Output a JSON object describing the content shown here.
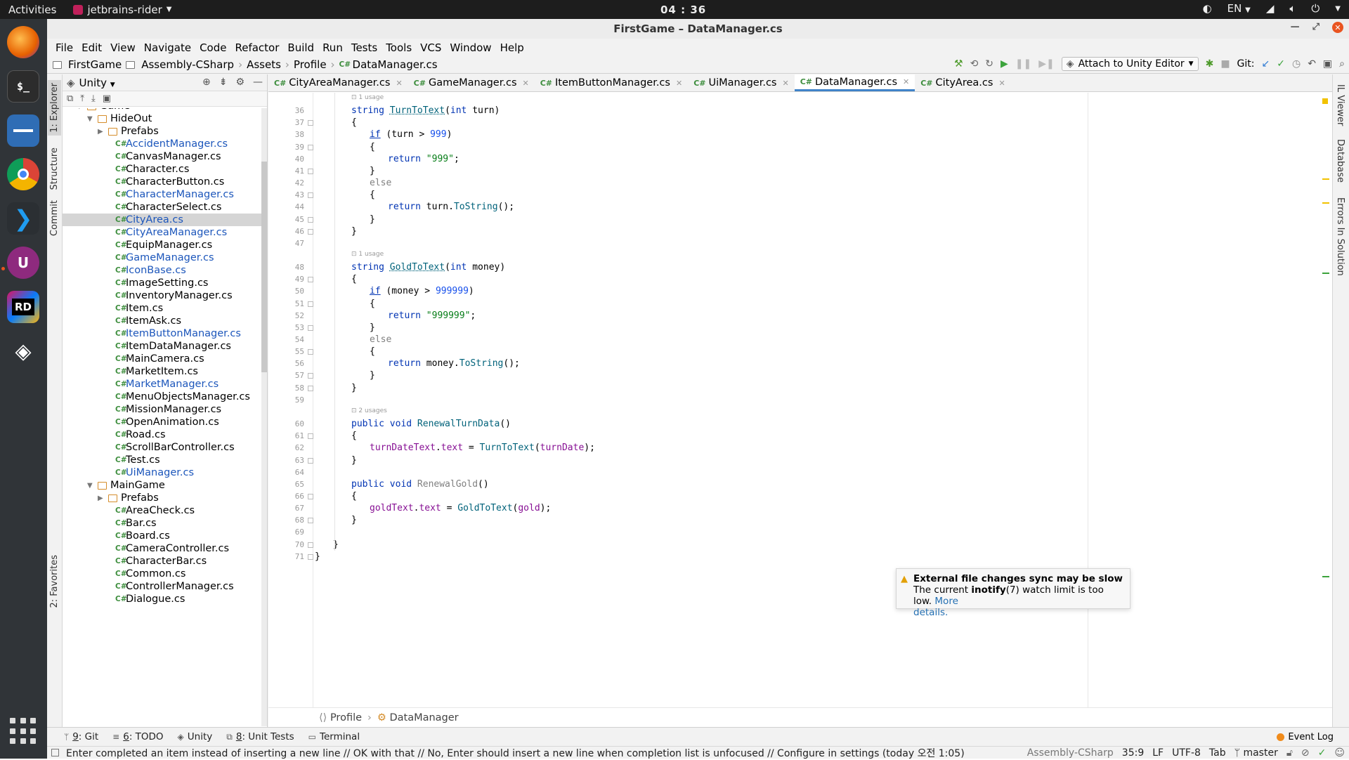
{
  "topbar": {
    "activities": "Activities",
    "app": "jetbrains-rider",
    "clock": "04 : 36",
    "lang": "EN"
  },
  "window": {
    "title": "FirstGame – DataManager.cs"
  },
  "menu": [
    "File",
    "Edit",
    "View",
    "Navigate",
    "Code",
    "Refactor",
    "Build",
    "Run",
    "Tests",
    "Tools",
    "VCS",
    "Window",
    "Help"
  ],
  "nav": {
    "crumbs": [
      "FirstGame",
      "Assembly-CSharp",
      "Assets",
      "Profile",
      "DataManager.cs"
    ],
    "attach": "Attach to Unity Editor",
    "git": "Git:"
  },
  "explorer": {
    "title": "Unity"
  },
  "tree": [
    {
      "label": "Game",
      "type": "folder",
      "depth": 0,
      "arrow": "▼"
    },
    {
      "label": "HideOut",
      "type": "folder",
      "depth": 1,
      "arrow": "▼"
    },
    {
      "label": "Prefabs",
      "type": "folder",
      "depth": 2,
      "arrow": "▶"
    },
    {
      "label": "AccidentManager.cs",
      "type": "file",
      "depth": 2,
      "modified": true
    },
    {
      "label": "CanvasManager.cs",
      "type": "file",
      "depth": 2
    },
    {
      "label": "Character.cs",
      "type": "file",
      "depth": 2
    },
    {
      "label": "CharacterButton.cs",
      "type": "file",
      "depth": 2
    },
    {
      "label": "CharacterManager.cs",
      "type": "file",
      "depth": 2,
      "modified": true
    },
    {
      "label": "CharacterSelect.cs",
      "type": "file",
      "depth": 2
    },
    {
      "label": "CityArea.cs",
      "type": "file",
      "depth": 2,
      "modified": true,
      "selected": true
    },
    {
      "label": "CityAreaManager.cs",
      "type": "file",
      "depth": 2,
      "modified": true
    },
    {
      "label": "EquipManager.cs",
      "type": "file",
      "depth": 2
    },
    {
      "label": "GameManager.cs",
      "type": "file",
      "depth": 2,
      "modified": true
    },
    {
      "label": "IconBase.cs",
      "type": "file",
      "depth": 2,
      "modified": true
    },
    {
      "label": "ImageSetting.cs",
      "type": "file",
      "depth": 2
    },
    {
      "label": "InventoryManager.cs",
      "type": "file",
      "depth": 2
    },
    {
      "label": "Item.cs",
      "type": "file",
      "depth": 2
    },
    {
      "label": "ItemAsk.cs",
      "type": "file",
      "depth": 2
    },
    {
      "label": "ItemButtonManager.cs",
      "type": "file",
      "depth": 2,
      "modified": true
    },
    {
      "label": "ItemDataManager.cs",
      "type": "file",
      "depth": 2
    },
    {
      "label": "MainCamera.cs",
      "type": "file",
      "depth": 2
    },
    {
      "label": "MarketItem.cs",
      "type": "file",
      "depth": 2
    },
    {
      "label": "MarketManager.cs",
      "type": "file",
      "depth": 2,
      "modified": true
    },
    {
      "label": "MenuObjectsManager.cs",
      "type": "file",
      "depth": 2
    },
    {
      "label": "MissionManager.cs",
      "type": "file",
      "depth": 2
    },
    {
      "label": "OpenAnimation.cs",
      "type": "file",
      "depth": 2
    },
    {
      "label": "Road.cs",
      "type": "file",
      "depth": 2
    },
    {
      "label": "ScrollBarController.cs",
      "type": "file",
      "depth": 2
    },
    {
      "label": "Test.cs",
      "type": "file",
      "depth": 2
    },
    {
      "label": "UiManager.cs",
      "type": "file",
      "depth": 2,
      "modified": true
    },
    {
      "label": "MainGame",
      "type": "folder",
      "depth": 1,
      "arrow": "▼"
    },
    {
      "label": "Prefabs",
      "type": "folder",
      "depth": 2,
      "arrow": "▶"
    },
    {
      "label": "AreaCheck.cs",
      "type": "file",
      "depth": 2
    },
    {
      "label": "Bar.cs",
      "type": "file",
      "depth": 2
    },
    {
      "label": "Board.cs",
      "type": "file",
      "depth": 2
    },
    {
      "label": "CameraController.cs",
      "type": "file",
      "depth": 2
    },
    {
      "label": "CharacterBar.cs",
      "type": "file",
      "depth": 2
    },
    {
      "label": "Common.cs",
      "type": "file",
      "depth": 2
    },
    {
      "label": "ControllerManager.cs",
      "type": "file",
      "depth": 2
    },
    {
      "label": "Dialogue.cs",
      "type": "file",
      "depth": 2
    }
  ],
  "tabs": [
    {
      "label": "CityAreaManager.cs"
    },
    {
      "label": "GameManager.cs"
    },
    {
      "label": "ItemButtonManager.cs"
    },
    {
      "label": "UiManager.cs"
    },
    {
      "label": "DataManager.cs",
      "active": true
    },
    {
      "label": "CityArea.cs"
    }
  ],
  "code": [
    {
      "hint": "1 usage"
    },
    {
      "n": "36",
      "ind": 0,
      "tokens": [
        [
          "kw",
          "string "
        ],
        [
          "fn-ul",
          "TurnToText"
        ],
        [
          "",
          "("
        ],
        [
          "kw",
          "int "
        ],
        [
          "",
          "turn)"
        ]
      ]
    },
    {
      "n": "37",
      "ind": 0,
      "tokens": [
        [
          "",
          "{"
        ]
      ]
    },
    {
      "n": "38",
      "ind": 1,
      "tokens": [
        [
          "kw2",
          "if"
        ],
        [
          "",
          " (turn > "
        ],
        [
          "num",
          "999"
        ],
        [
          "",
          ")"
        ]
      ]
    },
    {
      "n": "39",
      "ind": 1,
      "tokens": [
        [
          "",
          "{"
        ]
      ]
    },
    {
      "n": "40",
      "ind": 2,
      "tokens": [
        [
          "kw",
          "return "
        ],
        [
          "str",
          "\"999\""
        ],
        [
          "",
          ";"
        ]
      ]
    },
    {
      "n": "41",
      "ind": 1,
      "tokens": [
        [
          "",
          "}"
        ]
      ]
    },
    {
      "n": "42",
      "ind": 1,
      "tokens": [
        [
          "else",
          "else"
        ]
      ]
    },
    {
      "n": "43",
      "ind": 1,
      "tokens": [
        [
          "",
          "{"
        ]
      ]
    },
    {
      "n": "44",
      "ind": 2,
      "tokens": [
        [
          "kw",
          "return "
        ],
        [
          "",
          "turn."
        ],
        [
          "fn",
          "ToString"
        ],
        [
          "",
          "();"
        ]
      ]
    },
    {
      "n": "45",
      "ind": 1,
      "tokens": [
        [
          "",
          "}"
        ]
      ]
    },
    {
      "n": "46",
      "ind": 0,
      "tokens": [
        [
          "",
          "}"
        ]
      ]
    },
    {
      "n": "47",
      "ind": 0,
      "tokens": []
    },
    {
      "hint": "1 usage"
    },
    {
      "n": "48",
      "ind": 0,
      "tokens": [
        [
          "kw",
          "string "
        ],
        [
          "fn-ul",
          "GoldToText"
        ],
        [
          "",
          "("
        ],
        [
          "kw",
          "int "
        ],
        [
          "",
          "money)"
        ]
      ]
    },
    {
      "n": "49",
      "ind": 0,
      "tokens": [
        [
          "",
          "{"
        ]
      ]
    },
    {
      "n": "50",
      "ind": 1,
      "tokens": [
        [
          "kw2",
          "if"
        ],
        [
          "",
          " (money > "
        ],
        [
          "num",
          "999999"
        ],
        [
          "",
          ")"
        ]
      ]
    },
    {
      "n": "51",
      "ind": 1,
      "tokens": [
        [
          "",
          "{"
        ]
      ]
    },
    {
      "n": "52",
      "ind": 2,
      "tokens": [
        [
          "kw",
          "return "
        ],
        [
          "str",
          "\"999999\""
        ],
        [
          "",
          ";"
        ]
      ]
    },
    {
      "n": "53",
      "ind": 1,
      "tokens": [
        [
          "",
          "}"
        ]
      ]
    },
    {
      "n": "54",
      "ind": 1,
      "tokens": [
        [
          "else",
          "else"
        ]
      ]
    },
    {
      "n": "55",
      "ind": 1,
      "tokens": [
        [
          "",
          "{"
        ]
      ]
    },
    {
      "n": "56",
      "ind": 2,
      "tokens": [
        [
          "kw",
          "return "
        ],
        [
          "",
          "money."
        ],
        [
          "fn",
          "ToString"
        ],
        [
          "",
          "();"
        ]
      ]
    },
    {
      "n": "57",
      "ind": 1,
      "tokens": [
        [
          "",
          "}"
        ]
      ]
    },
    {
      "n": "58",
      "ind": 0,
      "tokens": [
        [
          "",
          "}"
        ]
      ]
    },
    {
      "n": "59",
      "ind": 0,
      "tokens": []
    },
    {
      "hint": "2 usages"
    },
    {
      "n": "60",
      "ind": 0,
      "tokens": [
        [
          "kw",
          "public void "
        ],
        [
          "fn",
          "RenewalTurnData"
        ],
        [
          "",
          "()"
        ]
      ]
    },
    {
      "n": "61",
      "ind": 0,
      "tokens": [
        [
          "",
          "{"
        ]
      ]
    },
    {
      "n": "62",
      "ind": 1,
      "tokens": [
        [
          "field",
          "turnDateText"
        ],
        [
          "",
          "."
        ],
        [
          "field",
          "text"
        ],
        [
          "",
          " = "
        ],
        [
          "fn",
          "TurnToText"
        ],
        [
          "",
          "("
        ],
        [
          "field",
          "turnDate"
        ],
        [
          "",
          ");"
        ]
      ]
    },
    {
      "n": "63",
      "ind": 0,
      "tokens": [
        [
          "",
          "}"
        ]
      ]
    },
    {
      "n": "64",
      "ind": 0,
      "tokens": []
    },
    {
      "n": "65",
      "ind": 0,
      "tokens": [
        [
          "kw",
          "public void "
        ],
        [
          "unused",
          "RenewalGold"
        ],
        [
          "",
          "()"
        ]
      ]
    },
    {
      "n": "66",
      "ind": 0,
      "tokens": [
        [
          "",
          "{"
        ]
      ]
    },
    {
      "n": "67",
      "ind": 1,
      "tokens": [
        [
          "field",
          "goldText"
        ],
        [
          "",
          "."
        ],
        [
          "field",
          "text"
        ],
        [
          "",
          " = "
        ],
        [
          "fn",
          "GoldToText"
        ],
        [
          "",
          "("
        ],
        [
          "field",
          "gold"
        ],
        [
          "",
          ");"
        ]
      ]
    },
    {
      "n": "68",
      "ind": 0,
      "tokens": [
        [
          "",
          "}"
        ]
      ]
    },
    {
      "n": "69",
      "ind": 0,
      "tokens": []
    },
    {
      "n": "70",
      "ind": -1,
      "tokens": [
        [
          "",
          "}"
        ]
      ]
    },
    {
      "n": "71",
      "ind": -2,
      "tokens": [
        [
          "",
          "}"
        ]
      ]
    }
  ],
  "editor_breadcrumb": [
    "Profile",
    "DataManager"
  ],
  "right_tabs": [
    "IL Viewer",
    "Database",
    "Errors In Solution"
  ],
  "left_tabs": [
    "1: Explorer",
    "Structure",
    "Commit",
    "2: Favorites"
  ],
  "notification": {
    "title": "External file changes sync may be slow",
    "body_pre": "The current ",
    "body_bold": "inotify",
    "body_post": "(7) watch limit is too low. ",
    "link1": "More",
    "link2": "details."
  },
  "tooltabs": [
    {
      "key": "9",
      "label": ": Git"
    },
    {
      "key": "6",
      "label": ": TODO"
    },
    {
      "key": "",
      "label": "Unity"
    },
    {
      "key": "8",
      "label": ": Unit Tests"
    },
    {
      "key": "",
      "label": "Terminal"
    }
  ],
  "event_log": "Event Log",
  "status": {
    "message": "Enter completed an item instead of inserting a new line // OK with that // No, Enter should insert a new line when completion list is unfocused // Configure in settings (today 오전 1:05)",
    "project": "Assembly-CSharp",
    "position": "35:9",
    "line_sep": "LF",
    "encoding": "UTF-8",
    "indent": "Tab",
    "branch": "master"
  }
}
